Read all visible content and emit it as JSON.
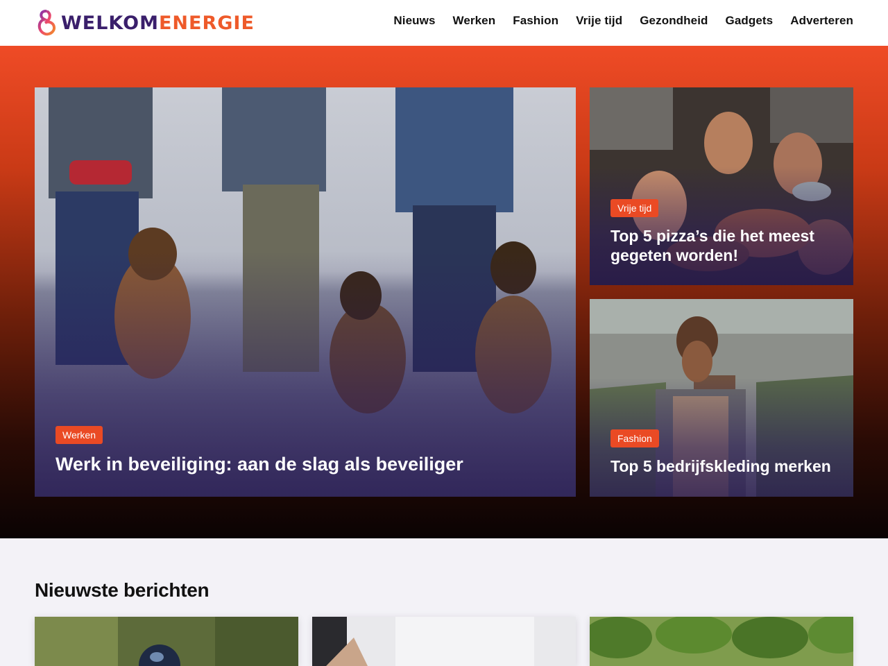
{
  "brand": {
    "name_part1": "WELKOM",
    "name_part2": "ENERGIE",
    "accent": "#ea4a24",
    "purple": "#3a1f6b"
  },
  "nav": {
    "items": [
      "Nieuws",
      "Werken",
      "Fashion",
      "Vrije tijd",
      "Gezondheid",
      "Gadgets",
      "Adverteren"
    ]
  },
  "hero": {
    "featured": {
      "category": "Werken",
      "title": "Werk in beveiliging: aan de slag als beveiliger",
      "image_icon": "security-dogs-photo"
    },
    "side1": {
      "category": "Vrije tijd",
      "title": "Top 5 pizza’s die het meest gegeten worden!",
      "image_icon": "pizza-party-photo"
    },
    "side2": {
      "category": "Fashion",
      "title": "Top 5 bedrijfskleding merken",
      "image_icon": "greenhouse-worker-photo"
    }
  },
  "latest": {
    "heading": "Nieuwste berichten",
    "thumbs": [
      "motorcycle-helmet-photo",
      "white-shirt-photo",
      "green-trees-photo"
    ]
  }
}
